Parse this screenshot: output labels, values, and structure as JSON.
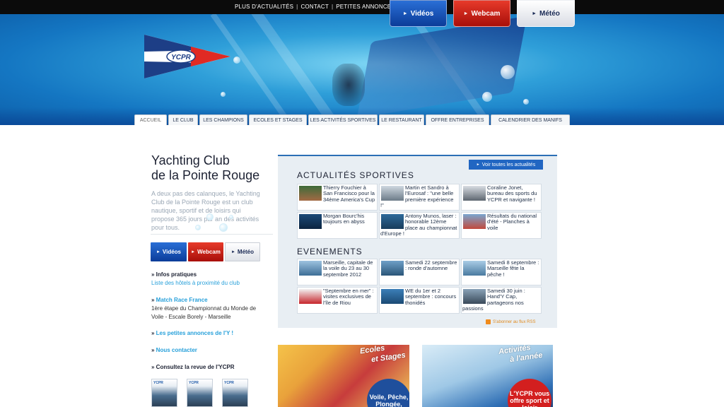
{
  "topnav": {
    "links": [
      "PLUS D'ACTUALITÉS",
      "CONTACT",
      "PETITES ANNONCES"
    ],
    "separator": "|"
  },
  "logo": {
    "text": "YCPR"
  },
  "media_buttons": {
    "videos": "Vidéos",
    "webcam": "Webcam",
    "meteo": "Météo"
  },
  "tabs": [
    "ACCUEIL",
    "LE CLUB",
    "LES CHAMPIONS",
    "ECOLES ET STAGES",
    "LES ACTIVITÉS SPORTIVES",
    "LE RESTAURANT",
    "OFFRE ENTREPRISES",
    "CALENDRIER DES MANIFS"
  ],
  "club": {
    "title_line1": "Yachting Club",
    "title_line2": "de la Pointe Rouge",
    "intro": "A deux pas des calanques, le Yachting Club de la Pointe Rouge est un club nautique, sportif et de loisirs qui propose 365 jours par an des activités pour tous."
  },
  "sidebar": {
    "infos_pratiques": "Infos pratiques",
    "hotels_link": "Liste des hôtels à proximité du club",
    "match_race": "Match Race France",
    "match_race_line1": "1ère étape du Championnat du Monde de",
    "match_race_line2": "Voile - Escale Borely - Marseille",
    "petites_annonces": "Les petites annonces de l'Y !",
    "contact": "Nous contacter",
    "revue": "Consultez la revue de l'YCPR",
    "revue_label": "YCPR"
  },
  "news": {
    "voir_toutes": "Voir toutes les actualités",
    "actualites_title": "ACTUALITÉS SPORTIVES",
    "actualites": [
      "Thierry Fouchier à San Francisco pour la 34ème America's Cup",
      "Martin et Sandro à l'Eurosaf : \"une belle première expérience !\"",
      "Coraline Jonet, bureau des sports du YCPR et navigante !",
      "Morgan Bourc'his toujours en abyss",
      "Antony Munos, laser : honorable 12ème place au championnat d'Europe !",
      "Résultats du national d'été - Planches à voile"
    ],
    "evenements_title": "EVENEMENTS",
    "evenements": [
      "Marseille, capitale de la voile du 23 au 30 septembre 2012",
      "Samedi 22 septembre : ronde d'automne",
      "Samedi 8 septembre : Marseille fête la pêche !",
      "\"Septembre en mer\" : visites exclusives de l'île de Riou",
      "WE du 1er et 2 septembre : concours thonidés",
      "Samedi 30 juin : Hand'Y Cap, partageons nos passions"
    ],
    "rss": "S'abonner au flux RSS"
  },
  "promos": {
    "ecoles_title1": "Ecoles",
    "ecoles_title2": "et Stages",
    "ecoles_circle": "Voile, Pêche, Plongée,",
    "activites_title1": "Activités",
    "activites_title2": "à l'année",
    "activites_circle": "L'YCPR vous offre sport et loisir"
  },
  "colors": {
    "accent_blue": "#27a0da",
    "video_blue": "#0b3c99",
    "webcam_red": "#a80f0a",
    "panel_bg": "#e8eef3"
  }
}
